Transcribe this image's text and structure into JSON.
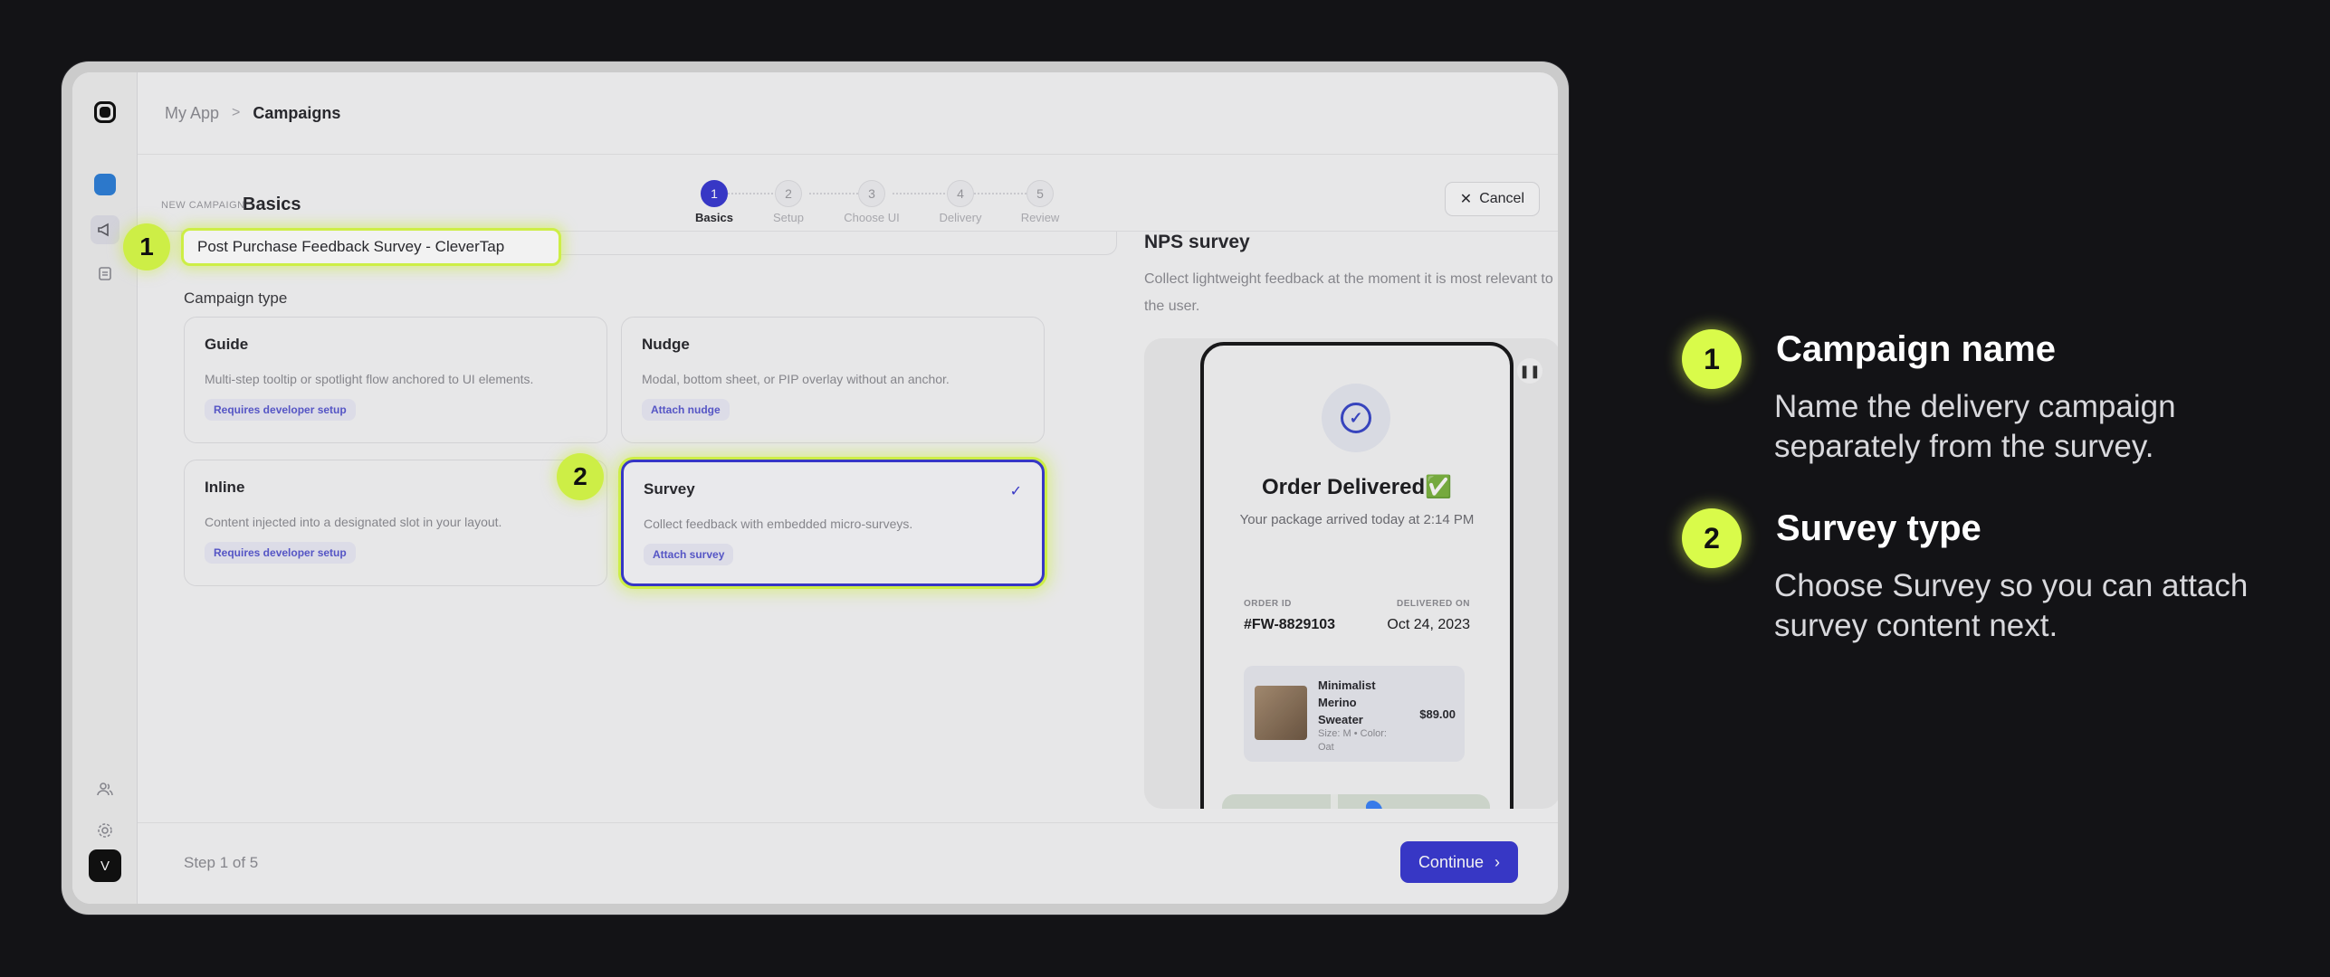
{
  "breadcrumb": {
    "app": "My App",
    "separator": ">",
    "current": "Campaigns"
  },
  "rail": {
    "avatar_initial": "V"
  },
  "header": {
    "eyebrow": "NEW CAMPAIGN",
    "title": "Basics",
    "cancel_label": "Cancel",
    "steps": [
      {
        "num": "1",
        "label": "Basics"
      },
      {
        "num": "2",
        "label": "Setup"
      },
      {
        "num": "3",
        "label": "Choose UI"
      },
      {
        "num": "4",
        "label": "Delivery"
      },
      {
        "num": "5",
        "label": "Review"
      }
    ]
  },
  "form": {
    "campaign_name_value": "Post Purchase Feedback Survey - CleverTap",
    "section_title": "Campaign type",
    "cards": [
      {
        "title": "Guide",
        "desc": "Multi-step tooltip or spotlight flow anchored to UI elements.",
        "badge": "Requires developer setup"
      },
      {
        "title": "Nudge",
        "desc": "Modal, bottom sheet, or PIP overlay without an anchor.",
        "badge": "Attach nudge"
      },
      {
        "title": "Inline",
        "desc": "Content injected into a designated slot in your layout.",
        "badge": "Requires developer setup"
      },
      {
        "title": "Survey",
        "desc": "Collect feedback with embedded micro-surveys.",
        "badge": "Attach survey",
        "selected": "✓"
      }
    ]
  },
  "preview": {
    "title": "NPS survey",
    "desc": "Collect lightweight feedback at the moment it is most relevant to the user.",
    "order": {
      "heading": "Order Delivered✅",
      "sub": "Your package arrived today at 2:14 PM",
      "id_label": "ORDER ID",
      "id_value": "#FW-8829103",
      "delivered_label": "DELIVERED ON",
      "delivered_value": "Oct 24, 2023",
      "item_name": "Minimalist Merino Sweater",
      "item_attr": "Size: M • Color: Oat",
      "item_price": "$89.00"
    }
  },
  "footer": {
    "step_text": "Step 1 of 5",
    "continue_label": "Continue"
  },
  "callouts": [
    "1",
    "2"
  ],
  "legend": [
    {
      "num": "1",
      "title": "Campaign name",
      "body": "Name the delivery campaign separately from the survey."
    },
    {
      "num": "2",
      "title": "Survey type",
      "body": "Choose Survey so you can attach survey content next."
    }
  ],
  "colors": {
    "accent": "#3a3ad0",
    "highlight": "#d9fb4a",
    "background": "#131316"
  }
}
